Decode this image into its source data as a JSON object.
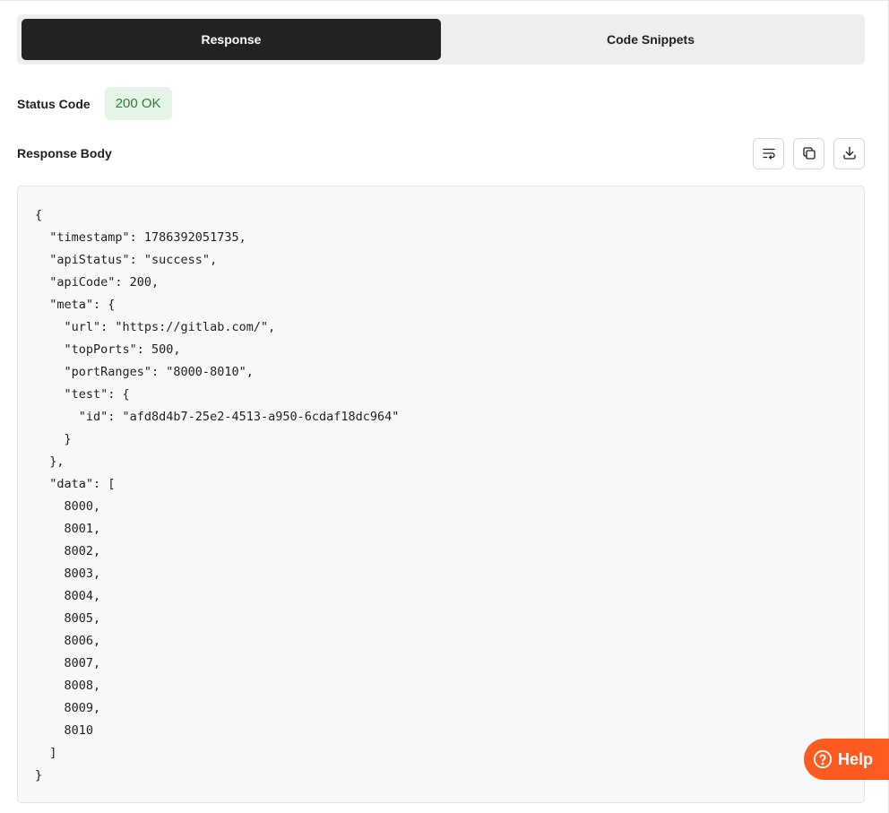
{
  "tabs": [
    {
      "label": "Response",
      "active": true
    },
    {
      "label": "Code Snippets",
      "active": false
    }
  ],
  "status": {
    "label": "Status Code",
    "value": "200 OK",
    "color": "#2e7d32"
  },
  "response_body": {
    "title": "Response Body",
    "actions": [
      {
        "name": "wrap-text-icon"
      },
      {
        "name": "copy-icon"
      },
      {
        "name": "download-icon"
      }
    ],
    "lines": [
      "{",
      "  \"timestamp\": 1786392051735,",
      "  \"apiStatus\": \"success\",",
      "  \"apiCode\": 200,",
      "  \"meta\": {",
      "    \"url\": \"https://gitlab.com/\",",
      "    \"topPorts\": 500,",
      "    \"portRanges\": \"8000-8010\",",
      "    \"test\": {",
      "      \"id\": \"afd8d4b7-25e2-4513-a950-6cdaf18dc964\"",
      "    }",
      "  },",
      "  \"data\": [",
      "    8000,",
      "    8001,",
      "    8002,",
      "    8003,",
      "    8004,",
      "    8005,",
      "    8006,",
      "    8007,",
      "    8008,",
      "    8009,",
      "    8010",
      "  ]",
      "}"
    ]
  },
  "help": {
    "label": "Help",
    "icon": "question-circle-icon",
    "color": "#ff5a1f"
  }
}
